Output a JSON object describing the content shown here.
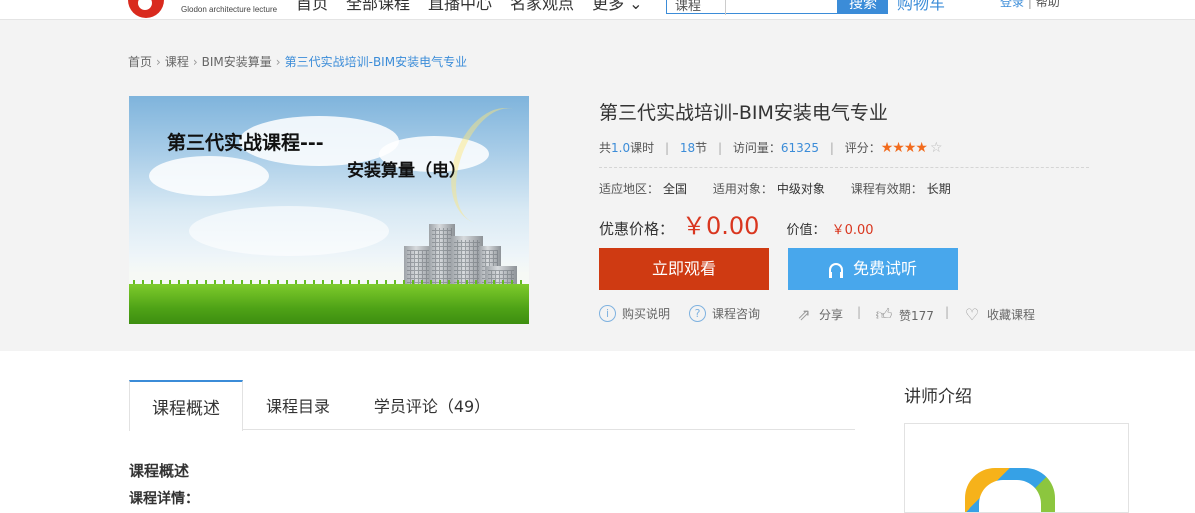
{
  "header": {
    "logo_sub": "Glodon architecture lecture",
    "nav": [
      "首页",
      "全部课程",
      "直播中心",
      "名家观点",
      "更多"
    ],
    "search_category": "课程",
    "search_button": "搜索",
    "cart": "购物车",
    "login": "登录",
    "help": "帮助"
  },
  "breadcrumb": {
    "items": [
      "首页",
      "课程",
      "BIM安装算量"
    ],
    "current": "第三代实战培训-BIM安装电气专业"
  },
  "cover": {
    "line1": "第三代实战课程---",
    "line2": "安装算量（电）"
  },
  "course": {
    "title": "第三代实战培训-BIM安装电气专业",
    "hours_prefix": "共",
    "hours": "1.0",
    "hours_suffix": "课时",
    "sections": "18",
    "sections_suffix": "节",
    "visits_label": "访问量：",
    "visits": "61325",
    "rating_label": "评分：",
    "rating": 4,
    "rating_max": 5,
    "region_label": "适应地区：",
    "region": "全国",
    "audience_label": "适用对象：",
    "audience": "中级对象",
    "validity_label": "课程有效期：",
    "validity": "长期",
    "price_label": "优惠价格：",
    "price": "￥0.00",
    "value_label": "价值：",
    "value": "￥0.00",
    "price_color": "#d9361f"
  },
  "buttons": {
    "watch": "立即观看",
    "trial": "免费试听",
    "watch_color": "#cf3a12",
    "trial_color": "#48a7ec"
  },
  "actions": {
    "purchase_info": "购买说明",
    "consult": "课程咨询",
    "share": "分享",
    "like": "赞177",
    "favorite": "收藏课程"
  },
  "tabs": [
    {
      "label": "课程概述",
      "active": true
    },
    {
      "label": "课程目录",
      "active": false
    },
    {
      "label": "学员评论（49）",
      "active": false
    }
  ],
  "content": {
    "section_title": "课程概述",
    "section_sub": "课程详情："
  },
  "sidebar": {
    "teacher_title": "讲师介绍"
  },
  "colors": {
    "accent": "#3b8cd8",
    "band_bg": "#f3f3f3"
  }
}
